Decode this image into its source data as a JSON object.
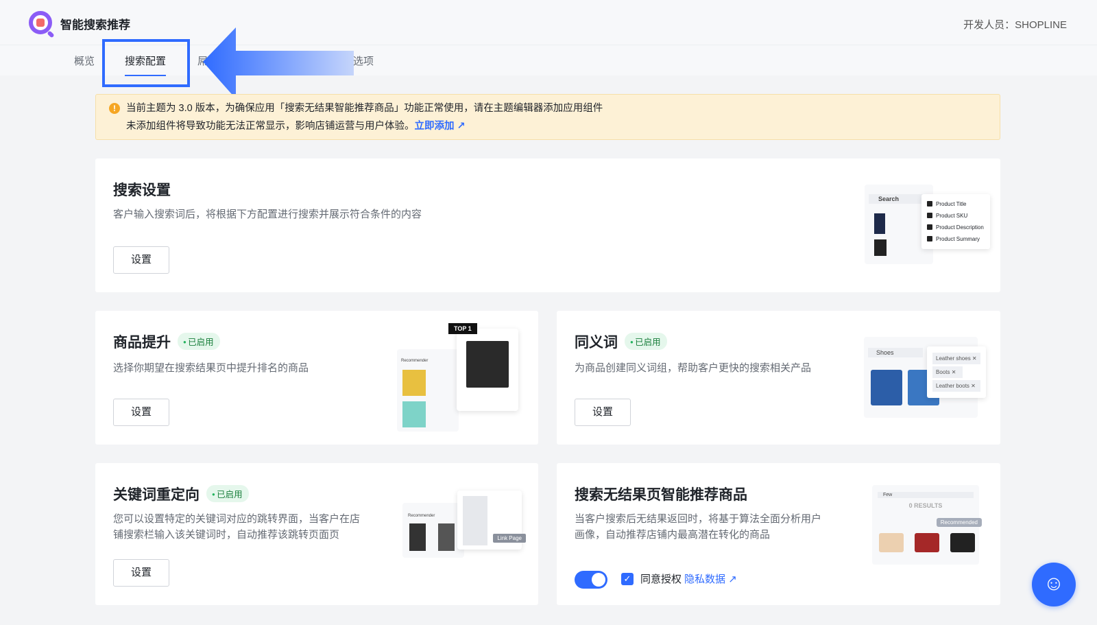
{
  "header": {
    "app_title": "智能搜索推荐",
    "developer": "开发人员：SHOPLINE"
  },
  "tabs": [
    {
      "label": "概览"
    },
    {
      "label": "搜索配置"
    },
    {
      "label": "屌"
    },
    {
      "label": "选项"
    }
  ],
  "alert": {
    "line1": "当前主题为 3.0 版本，为确保应用「搜索无结果智能推荐商品」功能正常使用，请在主题编辑器添加应用组件",
    "line2": "未添加组件将导致功能无法正常显示，影响店铺运营与用户体验。",
    "link": "立即添加"
  },
  "search_settings": {
    "title": "搜索设置",
    "desc": "客户输入搜索词后，将根据下方配置进行搜索并展示符合条件的内容",
    "button": "设置",
    "ill": {
      "search": "Search",
      "options": [
        "Product Title",
        "Product SKU",
        "Product Description",
        "Product Summary"
      ]
    }
  },
  "boost": {
    "title": "商品提升",
    "badge": "已启用",
    "desc": "选择你期望在搜索结果页中提升排名的商品",
    "button": "设置",
    "ill": {
      "top": "TOP 1",
      "label": "Recommender"
    }
  },
  "synonyms": {
    "title": "同义词",
    "badge": "已启用",
    "desc": "为商品创建同义词组，帮助客户更快的搜索相关产品",
    "button": "设置",
    "ill": {
      "search": "Shoes",
      "tags": [
        "Leather shoes",
        "Boots",
        "Leather boots"
      ]
    }
  },
  "redirect": {
    "title": "关键词重定向",
    "badge": "已启用",
    "desc1": "您可以设置特定的关键词对应的跳转界面，当客户在店",
    "desc2": "铺搜索栏输入该关键词时，自动推荐该跳转页面页",
    "button": "设置",
    "ill": {
      "label": "Recommender",
      "link": "Link Page"
    }
  },
  "no_result": {
    "title": "搜索无结果页智能推荐商品",
    "desc1": "当客户搜索后无结果返回时，将基于算法全面分析用户",
    "desc2": "画像，自动推荐店铺内最高潜在转化的商品",
    "toggle_on": true,
    "agree_checked": true,
    "agree": "同意授权",
    "privacy": "隐私数据",
    "ill": {
      "search": "Few",
      "results": "0 RESULTS",
      "recommended": "Recommended"
    }
  },
  "colors": {
    "accent": "#2f6bff",
    "warning": "#f5a623"
  }
}
